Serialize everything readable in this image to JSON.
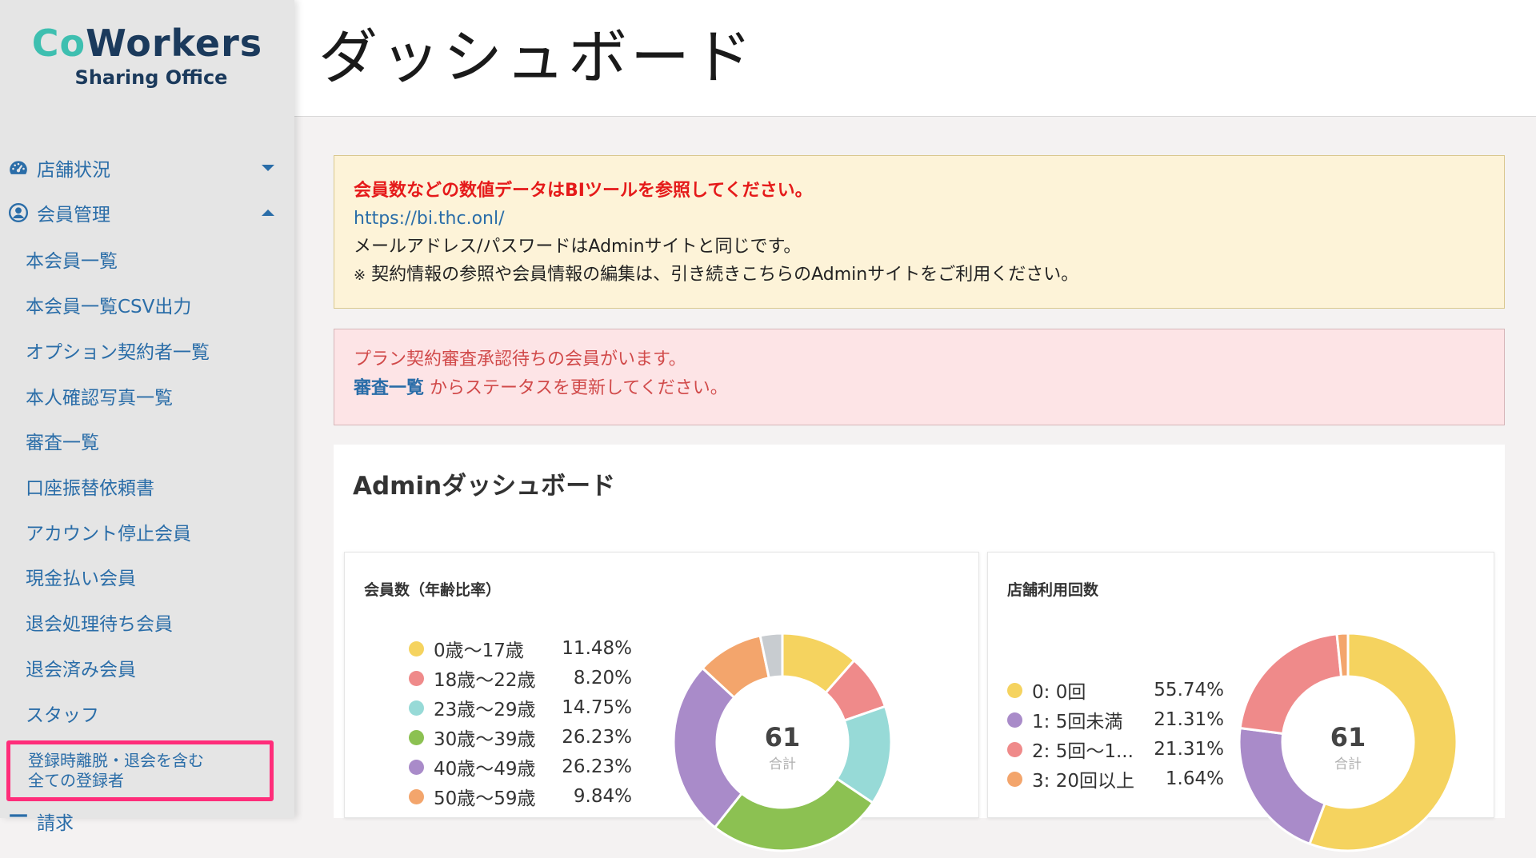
{
  "brand": {
    "co": "Co",
    "workers": "Workers",
    "subtitle": "Sharing Office"
  },
  "header": {
    "title": "ダッシュボード"
  },
  "sidebar": {
    "sections": [
      {
        "label": "店舗状況",
        "icon": "gauge-icon",
        "expanded": false
      },
      {
        "label": "会員管理",
        "icon": "user-circle-icon",
        "expanded": true
      }
    ],
    "items": [
      {
        "label": "本会員一覧"
      },
      {
        "label": "本会員一覧CSV出力"
      },
      {
        "label": "オプション契約者一覧"
      },
      {
        "label": "本人確認写真一覧"
      },
      {
        "label": "審査一覧"
      },
      {
        "label": "口座振替依頼書"
      },
      {
        "label": "アカウント停止会員"
      },
      {
        "label": "現金払い会員"
      },
      {
        "label": "退会処理待ち会員"
      },
      {
        "label": "退会済み会員"
      },
      {
        "label": "スタッフ"
      }
    ],
    "highlighted_item": {
      "line1": "登録時離脱・退会を含む",
      "line2": "全ての登録者"
    },
    "cut_item": {
      "label": "請求"
    }
  },
  "alerts": {
    "warning": {
      "headline": "会員数などの数値データはBIツールを参照してください。",
      "link": "https://bi.thc.onl/",
      "line2": "メールアドレス/パスワードはAdminサイトと同じです。",
      "note_mark": "※",
      "line3": "契約情報の参照や会員情報の編集は、引き続きこちらのAdminサイトをご利用ください。"
    },
    "danger": {
      "line1": "プラン契約審査承認待ちの会員がいます。",
      "link": "審査一覧",
      "line2_rest": "からステータスを更新してください。"
    }
  },
  "admin": {
    "title": "Adminダッシュボード",
    "cards": [
      {
        "title": "会員数（年齢比率）",
        "total": "61",
        "total_label": "合計",
        "legend": [
          {
            "label": "0歳〜17歳",
            "pct": "11.48%",
            "color": "#f5d35f"
          },
          {
            "label": "18歳〜22歳",
            "pct": "8.20%",
            "color": "#ef8a8a"
          },
          {
            "label": "23歳〜29歳",
            "pct": "14.75%",
            "color": "#97dad7"
          },
          {
            "label": "30歳〜39歳",
            "pct": "26.23%",
            "color": "#8cc152"
          },
          {
            "label": "40歳〜49歳",
            "pct": "26.23%",
            "color": "#a98bc9"
          },
          {
            "label": "50歳〜59歳",
            "pct": "9.84%",
            "color": "#f3a56c"
          }
        ]
      },
      {
        "title": "店舗利用回数",
        "total": "61",
        "total_label": "合計",
        "legend": [
          {
            "label": "0: 0回",
            "pct": "55.74%",
            "color": "#f5d35f"
          },
          {
            "label": "1: 5回未満",
            "pct": "21.31%",
            "color": "#a98bc9"
          },
          {
            "label": "2: 5回〜1...",
            "pct": "21.31%",
            "color": "#ef8a8a"
          },
          {
            "label": "3: 20回以上",
            "pct": "1.64%",
            "color": "#f3a56c"
          }
        ]
      }
    ]
  },
  "chart_data": [
    {
      "type": "pie",
      "title": "会員数（年齢比率）",
      "categories": [
        "0歳〜17歳",
        "18歳〜22歳",
        "23歳〜29歳",
        "30歳〜39歳",
        "40歳〜49歳",
        "50歳〜59歳",
        ""
      ],
      "values": [
        11.48,
        8.2,
        14.75,
        26.23,
        26.23,
        9.84,
        3.28
      ],
      "colors": [
        "#f5d35f",
        "#ef8a8a",
        "#97dad7",
        "#8cc152",
        "#a98bc9",
        "#f3a56c",
        "#c8ccd0"
      ],
      "center_value": "61",
      "center_label": "合計"
    },
    {
      "type": "pie",
      "title": "店舗利用回数",
      "categories": [
        "0: 0回",
        "1: 5回未満",
        "2: 5回〜1...",
        "3: 20回以上"
      ],
      "values": [
        55.74,
        21.31,
        21.31,
        1.64
      ],
      "colors": [
        "#f5d35f",
        "#a98bc9",
        "#ef8a8a",
        "#f3a56c"
      ],
      "center_value": "61",
      "center_label": "合計"
    }
  ]
}
